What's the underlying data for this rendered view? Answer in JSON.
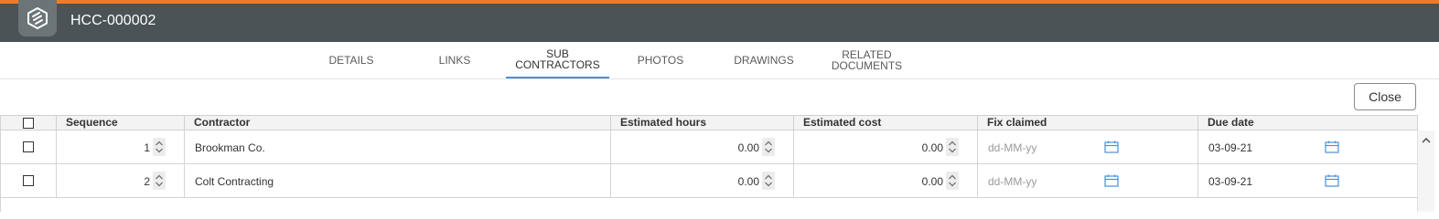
{
  "header": {
    "record_id": "HCC-000002",
    "logo_icon": "app-logo-icon",
    "accent_color": "#f07a2a",
    "bar_color": "#4a5355"
  },
  "tabs": [
    {
      "label_line1": "DETAILS",
      "label_line2": ""
    },
    {
      "label_line1": "LINKS",
      "label_line2": ""
    },
    {
      "label_line1": "SUB",
      "label_line2": "CONTRACTORS"
    },
    {
      "label_line1": "PHOTOS",
      "label_line2": ""
    },
    {
      "label_line1": "DRAWINGS",
      "label_line2": ""
    },
    {
      "label_line1": "RELATED",
      "label_line2": "DOCUMENTS"
    }
  ],
  "active_tab": "SUB CONTRACTORS",
  "actions": {
    "close_label": "Close"
  },
  "table": {
    "columns": [
      "Sequence",
      "Contractor",
      "Estimated hours",
      "Estimated cost",
      "Fix claimed",
      "Due date"
    ],
    "rows": [
      {
        "sequence": "1",
        "contractor": "Brookman Co.",
        "estimated_hours": "0.00",
        "estimated_cost": "0.00",
        "fix_claimed_placeholder": "dd-MM-yy",
        "due_date": "03-09-21"
      },
      {
        "sequence": "2",
        "contractor": "Colt Contracting",
        "estimated_hours": "0.00",
        "estimated_cost": "0.00",
        "fix_claimed_placeholder": "dd-MM-yy",
        "due_date": "03-09-21"
      }
    ]
  }
}
